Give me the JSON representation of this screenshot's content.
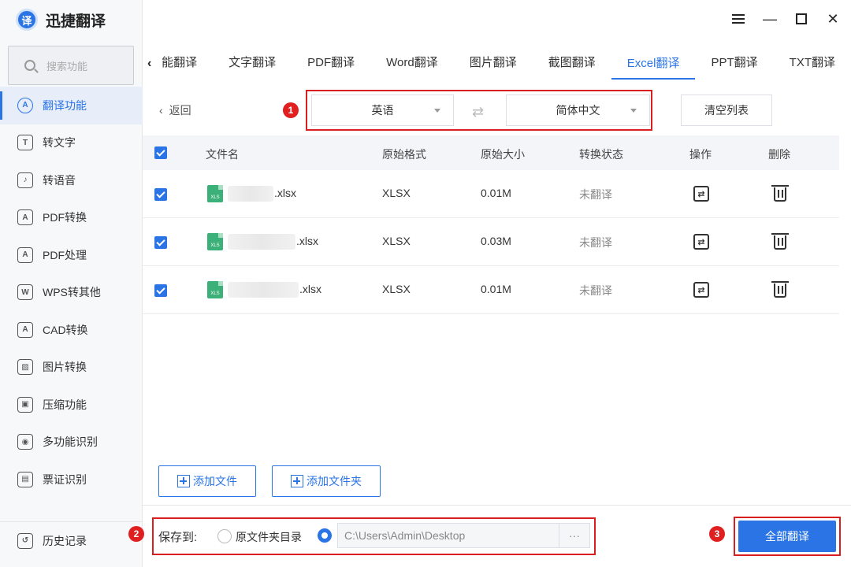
{
  "app": {
    "title": "迅捷翻译",
    "logo_glyph": "译",
    "accent_color": "#2a74e6"
  },
  "window_controls": [
    "menu-icon",
    "minimize-icon",
    "maximize-icon",
    "close-icon"
  ],
  "sidebar": {
    "search_placeholder": "搜索功能",
    "items": [
      {
        "label": "翻译功能",
        "icon": "translate-icon",
        "glyph": "A",
        "active": true
      },
      {
        "label": "转文字",
        "icon": "text-icon",
        "glyph": "T",
        "active": false
      },
      {
        "label": "转语音",
        "icon": "voice-icon",
        "glyph": "♪",
        "active": false
      },
      {
        "label": "PDF转换",
        "icon": "pdf-convert-icon",
        "glyph": "A",
        "active": false
      },
      {
        "label": "PDF处理",
        "icon": "pdf-process-icon",
        "glyph": "A",
        "active": false
      },
      {
        "label": "WPS转其他",
        "icon": "wps-icon",
        "glyph": "W",
        "active": false
      },
      {
        "label": "CAD转换",
        "icon": "cad-icon",
        "glyph": "A",
        "active": false
      },
      {
        "label": "图片转换",
        "icon": "image-icon",
        "glyph": "▨",
        "active": false
      },
      {
        "label": "压缩功能",
        "icon": "compress-icon",
        "glyph": "▣",
        "active": false
      },
      {
        "label": "多功能识别",
        "icon": "eye-icon",
        "glyph": "◉",
        "active": false
      },
      {
        "label": "票证识别",
        "icon": "ticket-icon",
        "glyph": "▤",
        "active": false
      }
    ],
    "history_label": "历史记录"
  },
  "tabs": [
    {
      "label": "能翻译",
      "active": false
    },
    {
      "label": "文字翻译",
      "active": false
    },
    {
      "label": "PDF翻译",
      "active": false
    },
    {
      "label": "Word翻译",
      "active": false
    },
    {
      "label": "图片翻译",
      "active": false
    },
    {
      "label": "截图翻译",
      "active": false
    },
    {
      "label": "Excel翻译",
      "active": true
    },
    {
      "label": "PPT翻译",
      "active": false
    },
    {
      "label": "TXT翻译",
      "active": false
    }
  ],
  "toolbar": {
    "back_label": "返回",
    "source_lang": "英语",
    "target_lang": "简体中文",
    "clear_label": "清空列表"
  },
  "markers": [
    "1",
    "2",
    "3"
  ],
  "table": {
    "headers": [
      "文件名",
      "原始格式",
      "原始大小",
      "转换状态",
      "操作",
      "删除"
    ],
    "rows": [
      {
        "name": ".xlsx",
        "format": "XLSX",
        "size": "0.01M",
        "status": "未翻译",
        "checked": true
      },
      {
        "name": ".xlsx",
        "format": "XLSX",
        "size": "0.03M",
        "status": "未翻译",
        "checked": true
      },
      {
        "name": ".xlsx",
        "format": "XLSX",
        "size": "0.01M",
        "status": "未翻译",
        "checked": true
      }
    ],
    "file_icon_label": "XLS"
  },
  "actions": {
    "add_file": "添加文件",
    "add_folder": "添加文件夹"
  },
  "footer": {
    "save_to_label": "保存到:",
    "option_original": "原文件夹目录",
    "option_custom_selected": true,
    "path_value": "C:\\Users\\Admin\\Desktop",
    "browse_label": "···",
    "translate_all": "全部翻译"
  }
}
